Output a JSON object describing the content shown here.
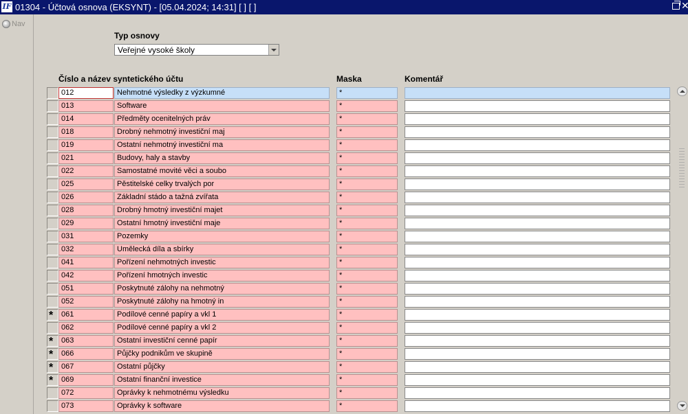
{
  "window": {
    "icon": "app-logo-icon",
    "icon_text": "IF",
    "title": "01304 - Účtová osnova (EKSYNT) - [05.04.2024; 14:31]  [ ]  [ ]"
  },
  "nav": {
    "label": "Nav"
  },
  "filter": {
    "label": "Typ osnovy",
    "selected": "Veřejné vysoké školy"
  },
  "columns": {
    "number_name": "Číslo a název syntetického účtu",
    "mask": "Maska",
    "comment": "Komentář"
  },
  "rows": [
    {
      "mark": "",
      "code": "012",
      "name": "Nehmotné výsledky z výzkumné",
      "mask": "*",
      "comment": ""
    },
    {
      "mark": "",
      "code": "013",
      "name": "Software",
      "mask": "*",
      "comment": ""
    },
    {
      "mark": "",
      "code": "014",
      "name": "Předměty ocenitelných práv",
      "mask": "*",
      "comment": ""
    },
    {
      "mark": "",
      "code": "018",
      "name": "Drobný nehmotný investiční maj",
      "mask": "*",
      "comment": ""
    },
    {
      "mark": "",
      "code": "019",
      "name": "Ostatní nehmotný investiční ma",
      "mask": "*",
      "comment": ""
    },
    {
      "mark": "",
      "code": "021",
      "name": "Budovy, haly a stavby",
      "mask": "*",
      "comment": ""
    },
    {
      "mark": "",
      "code": "022",
      "name": "Samostatné movité věci a soubo",
      "mask": "*",
      "comment": ""
    },
    {
      "mark": "",
      "code": "025",
      "name": "Pěstitelské celky trvalých por",
      "mask": "*",
      "comment": ""
    },
    {
      "mark": "",
      "code": "026",
      "name": "Základní stádo a tažná zvířata",
      "mask": "*",
      "comment": ""
    },
    {
      "mark": "",
      "code": "028",
      "name": "Drobný hmotný investiční majet",
      "mask": "*",
      "comment": ""
    },
    {
      "mark": "",
      "code": "029",
      "name": "Ostatní hmotný investiční maje",
      "mask": "*",
      "comment": ""
    },
    {
      "mark": "",
      "code": "031",
      "name": "Pozemky",
      "mask": "*",
      "comment": ""
    },
    {
      "mark": "",
      "code": "032",
      "name": "Umělecká díla a sbírky",
      "mask": "*",
      "comment": ""
    },
    {
      "mark": "",
      "code": "041",
      "name": "Pořízení nehmotných investic",
      "mask": "*",
      "comment": ""
    },
    {
      "mark": "",
      "code": "042",
      "name": "Pořízení hmotných investic",
      "mask": "*",
      "comment": ""
    },
    {
      "mark": "",
      "code": "051",
      "name": "Poskytnuté zálohy na nehmotný",
      "mask": "*",
      "comment": ""
    },
    {
      "mark": "",
      "code": "052",
      "name": "Poskytnuté zálohy na hmotný in",
      "mask": "*",
      "comment": ""
    },
    {
      "mark": "*",
      "code": "061",
      "name": "Podílové cenné papíry a vkl 1",
      "mask": "*",
      "comment": ""
    },
    {
      "mark": "",
      "code": "062",
      "name": "Podílové cenné papíry a vkl 2",
      "mask": "*",
      "comment": ""
    },
    {
      "mark": "*",
      "code": "063",
      "name": "Ostatní investiční cenné papír",
      "mask": "*",
      "comment": ""
    },
    {
      "mark": "*",
      "code": "066",
      "name": "Půjčky podnikům ve skupině",
      "mask": "*",
      "comment": ""
    },
    {
      "mark": "*",
      "code": "067",
      "name": "Ostatní půjčky",
      "mask": "*",
      "comment": ""
    },
    {
      "mark": "*",
      "code": "069",
      "name": "Ostatní finanční investice",
      "mask": "*",
      "comment": ""
    },
    {
      "mark": "",
      "code": "072",
      "name": "Oprávky k nehmotnému výsledku",
      "mask": "*",
      "comment": ""
    },
    {
      "mark": "",
      "code": "073",
      "name": "Oprávky k software",
      "mask": "*",
      "comment": ""
    }
  ]
}
